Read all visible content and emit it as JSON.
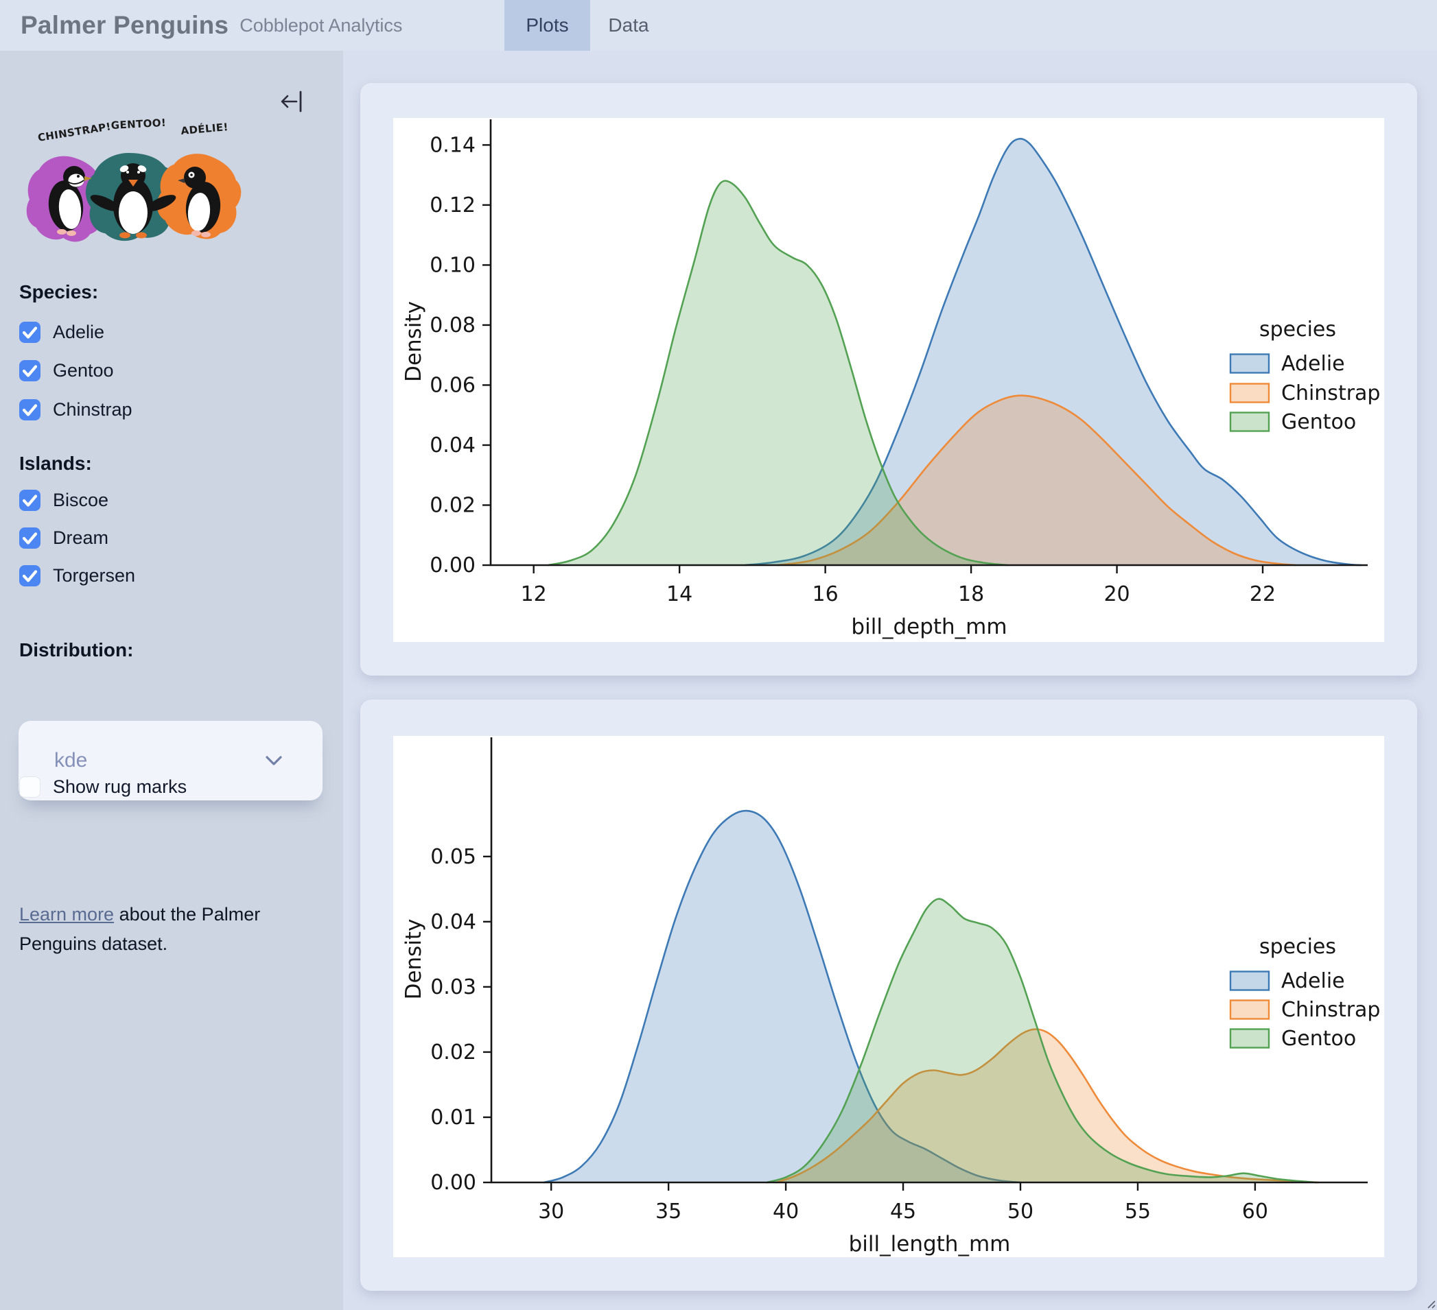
{
  "header": {
    "title": "Palmer Penguins",
    "subtitle": "Cobblepot Analytics",
    "tabs": [
      {
        "label": "Plots",
        "active": true
      },
      {
        "label": "Data",
        "active": false
      }
    ]
  },
  "sidebar": {
    "collapse_icon": "collapse-sidebar-arrow-to-bar",
    "artwork_labels": [
      "CHINSTRAP!",
      "GENTOO!",
      "ADÉLIE!"
    ],
    "species_heading": "Species:",
    "species": [
      {
        "label": "Adelie",
        "checked": true
      },
      {
        "label": "Gentoo",
        "checked": true
      },
      {
        "label": "Chinstrap",
        "checked": true
      }
    ],
    "islands_heading": "Islands:",
    "islands": [
      {
        "label": "Biscoe",
        "checked": true
      },
      {
        "label": "Dream",
        "checked": true
      },
      {
        "label": "Torgersen",
        "checked": true
      }
    ],
    "distribution_heading": "Distribution:",
    "distribution_value": "kde",
    "rug_label": "Show rug marks",
    "rug_checked": false,
    "learn_more_link": "Learn more",
    "learn_more_rest": " about the Palmer Penguins dataset."
  },
  "colors": {
    "header_bg": "#dbe2f0",
    "sidebar_bg": "#cdd5e2",
    "main_bg": "#d8dfee",
    "card_bg": "#e4eaf6",
    "tab_active_bg": "#bac9e4",
    "checkbox_blue": "#4c86f3",
    "link": "#5a6b92",
    "adelie": "#3d7ab5",
    "chinstrap": "#ee8a38",
    "gentoo": "#53a253"
  },
  "chart_data": [
    {
      "type": "area",
      "kind": "kde-density",
      "xlabel": "bill_depth_mm",
      "ylabel": "Density",
      "xlim": [
        11.41,
        23.44
      ],
      "ylim": [
        0,
        0.149
      ],
      "x_ticks": [
        12,
        14,
        16,
        18,
        20,
        22
      ],
      "x_tick_labels": [
        "12",
        "14",
        "16",
        "18",
        "20",
        "22"
      ],
      "y_ticks": [
        0,
        0.02,
        0.04,
        0.06,
        0.08,
        0.1,
        0.12,
        0.14
      ],
      "y_tick_labels": [
        "0.00",
        "0.02",
        "0.04",
        "0.06",
        "0.08",
        "0.10",
        "0.12",
        "0.14"
      ],
      "grid": false,
      "legend": {
        "title": "species",
        "position": "center right"
      },
      "series": [
        {
          "name": "Adelie",
          "color": "#3d7ab5",
          "points": [
            [
              14.9,
              0
            ],
            [
              15.3,
              0.001
            ],
            [
              15.7,
              0.003
            ],
            [
              16.1,
              0.008
            ],
            [
              16.4,
              0.016
            ],
            [
              16.7,
              0.028
            ],
            [
              17.0,
              0.045
            ],
            [
              17.3,
              0.064
            ],
            [
              17.6,
              0.085
            ],
            [
              17.9,
              0.104
            ],
            [
              18.1,
              0.116
            ],
            [
              18.3,
              0.129
            ],
            [
              18.5,
              0.139
            ],
            [
              18.65,
              0.142
            ],
            [
              18.8,
              0.1405
            ],
            [
              19.0,
              0.134
            ],
            [
              19.2,
              0.126
            ],
            [
              19.5,
              0.111
            ],
            [
              19.8,
              0.094
            ],
            [
              20.1,
              0.077
            ],
            [
              20.4,
              0.061
            ],
            [
              20.7,
              0.048
            ],
            [
              21.0,
              0.038
            ],
            [
              21.2,
              0.032
            ],
            [
              21.45,
              0.0285
            ],
            [
              21.7,
              0.023
            ],
            [
              21.95,
              0.016
            ],
            [
              22.2,
              0.009
            ],
            [
              22.5,
              0.0045
            ],
            [
              22.85,
              0.0015
            ],
            [
              23.2,
              0.0002
            ],
            [
              23.35,
              0
            ]
          ]
        },
        {
          "name": "Chinstrap",
          "color": "#ee8a38",
          "points": [
            [
              15.35,
              0
            ],
            [
              15.8,
              0.0015
            ],
            [
              16.2,
              0.005
            ],
            [
              16.6,
              0.011
            ],
            [
              17.0,
              0.021
            ],
            [
              17.4,
              0.033
            ],
            [
              17.8,
              0.044
            ],
            [
              18.1,
              0.051
            ],
            [
              18.4,
              0.055
            ],
            [
              18.65,
              0.0565
            ],
            [
              18.9,
              0.0558
            ],
            [
              19.2,
              0.0532
            ],
            [
              19.5,
              0.0487
            ],
            [
              19.8,
              0.042
            ],
            [
              20.1,
              0.0345
            ],
            [
              20.4,
              0.027
            ],
            [
              20.7,
              0.0195
            ],
            [
              21.0,
              0.0135
            ],
            [
              21.3,
              0.008
            ],
            [
              21.6,
              0.004
            ],
            [
              21.9,
              0.0016
            ],
            [
              22.2,
              0.0005
            ],
            [
              22.45,
              0
            ]
          ]
        },
        {
          "name": "Gentoo",
          "color": "#53a253",
          "points": [
            [
              12.2,
              0
            ],
            [
              12.5,
              0.0015
            ],
            [
              12.8,
              0.005
            ],
            [
              13.1,
              0.014
            ],
            [
              13.4,
              0.03
            ],
            [
              13.7,
              0.055
            ],
            [
              13.95,
              0.079
            ],
            [
              14.2,
              0.101
            ],
            [
              14.4,
              0.119
            ],
            [
              14.55,
              0.127
            ],
            [
              14.7,
              0.1275
            ],
            [
              14.9,
              0.1225
            ],
            [
              15.1,
              0.114
            ],
            [
              15.3,
              0.1065
            ],
            [
              15.55,
              0.1025
            ],
            [
              15.75,
              0.1
            ],
            [
              15.95,
              0.0935
            ],
            [
              16.15,
              0.082
            ],
            [
              16.35,
              0.066
            ],
            [
              16.55,
              0.049
            ],
            [
              16.75,
              0.0345
            ],
            [
              16.95,
              0.023
            ],
            [
              17.15,
              0.0155
            ],
            [
              17.35,
              0.01
            ],
            [
              17.6,
              0.0055
            ],
            [
              17.9,
              0.0022
            ],
            [
              18.2,
              0.0007
            ],
            [
              18.5,
              0
            ]
          ]
        }
      ]
    },
    {
      "type": "area",
      "kind": "kde-density",
      "xlabel": "bill_length_mm",
      "ylabel": "Density",
      "xlim": [
        27.45,
        64.8
      ],
      "ylim": [
        0,
        0.0685
      ],
      "x_ticks": [
        30,
        35,
        40,
        45,
        50,
        55,
        60
      ],
      "x_tick_labels": [
        "30",
        "35",
        "40",
        "45",
        "50",
        "55",
        "60"
      ],
      "y_ticks": [
        0,
        0.01,
        0.02,
        0.03,
        0.04,
        0.05
      ],
      "y_tick_labels": [
        "0.00",
        "0.01",
        "0.02",
        "0.03",
        "0.04",
        "0.05"
      ],
      "grid": false,
      "legend": {
        "title": "species",
        "position": "center right"
      },
      "series": [
        {
          "name": "Adelie",
          "color": "#3d7ab5",
          "points": [
            [
              29.7,
              0
            ],
            [
              30.5,
              0.0008
            ],
            [
              31.3,
              0.0025
            ],
            [
              32.1,
              0.006
            ],
            [
              32.9,
              0.012
            ],
            [
              33.7,
              0.021
            ],
            [
              34.5,
              0.031
            ],
            [
              35.3,
              0.0405
            ],
            [
              36.1,
              0.048
            ],
            [
              36.9,
              0.0535
            ],
            [
              37.7,
              0.0563
            ],
            [
              38.4,
              0.057
            ],
            [
              39.1,
              0.0557
            ],
            [
              39.8,
              0.052
            ],
            [
              40.6,
              0.045
            ],
            [
              41.4,
              0.0362
            ],
            [
              42.2,
              0.027
            ],
            [
              43.0,
              0.0185
            ],
            [
              43.8,
              0.0118
            ],
            [
              44.5,
              0.008
            ],
            [
              45.2,
              0.0063
            ],
            [
              45.9,
              0.0052
            ],
            [
              46.6,
              0.0038
            ],
            [
              47.4,
              0.0022
            ],
            [
              48.2,
              0.001
            ],
            [
              49.1,
              0.0003
            ],
            [
              50.0,
              0
            ]
          ]
        },
        {
          "name": "Chinstrap",
          "color": "#ee8a38",
          "points": [
            [
              39.6,
              0
            ],
            [
              40.4,
              0.001
            ],
            [
              41.2,
              0.0025
            ],
            [
              42.0,
              0.0045
            ],
            [
              42.8,
              0.007
            ],
            [
              43.6,
              0.0097
            ],
            [
              44.3,
              0.0125
            ],
            [
              45.0,
              0.0152
            ],
            [
              45.7,
              0.0168
            ],
            [
              46.3,
              0.0172
            ],
            [
              46.9,
              0.0168
            ],
            [
              47.5,
              0.0165
            ],
            [
              48.1,
              0.0172
            ],
            [
              48.8,
              0.019
            ],
            [
              49.5,
              0.0213
            ],
            [
              50.1,
              0.0229
            ],
            [
              50.6,
              0.0235
            ],
            [
              51.1,
              0.0231
            ],
            [
              51.6,
              0.0217
            ],
            [
              52.1,
              0.0195
            ],
            [
              52.7,
              0.0163
            ],
            [
              53.3,
              0.0128
            ],
            [
              53.9,
              0.0097
            ],
            [
              54.5,
              0.0071
            ],
            [
              55.2,
              0.005
            ],
            [
              55.9,
              0.0035
            ],
            [
              56.6,
              0.0025
            ],
            [
              57.4,
              0.0017
            ],
            [
              58.2,
              0.0012
            ],
            [
              59.0,
              0.0008
            ],
            [
              60.0,
              0.0005
            ],
            [
              61.0,
              0.0003
            ],
            [
              62.0,
              0.0001
            ],
            [
              62.7,
              0
            ]
          ]
        },
        {
          "name": "Gentoo",
          "color": "#53a253",
          "points": [
            [
              39.2,
              0
            ],
            [
              40.0,
              0.0008
            ],
            [
              40.8,
              0.0025
            ],
            [
              41.6,
              0.006
            ],
            [
              42.4,
              0.011
            ],
            [
              43.2,
              0.018
            ],
            [
              44.0,
              0.026
            ],
            [
              44.8,
              0.0335
            ],
            [
              45.5,
              0.0387
            ],
            [
              46.0,
              0.042
            ],
            [
              46.5,
              0.0435
            ],
            [
              47.0,
              0.0425
            ],
            [
              47.6,
              0.0405
            ],
            [
              48.2,
              0.0398
            ],
            [
              48.8,
              0.039
            ],
            [
              49.4,
              0.0365
            ],
            [
              50.0,
              0.0315
            ],
            [
              50.6,
              0.025
            ],
            [
              51.2,
              0.0185
            ],
            [
              51.8,
              0.0135
            ],
            [
              52.4,
              0.0095
            ],
            [
              53.0,
              0.0068
            ],
            [
              53.8,
              0.0045
            ],
            [
              54.6,
              0.003
            ],
            [
              55.4,
              0.002
            ],
            [
              56.2,
              0.0013
            ],
            [
              57.0,
              0.001
            ],
            [
              58.0,
              0.0008
            ],
            [
              58.8,
              0.001
            ],
            [
              59.5,
              0.0014
            ],
            [
              60.2,
              0.001
            ],
            [
              61.0,
              0.0005
            ],
            [
              61.9,
              0.0002
            ],
            [
              62.6,
              0
            ]
          ]
        }
      ]
    }
  ]
}
